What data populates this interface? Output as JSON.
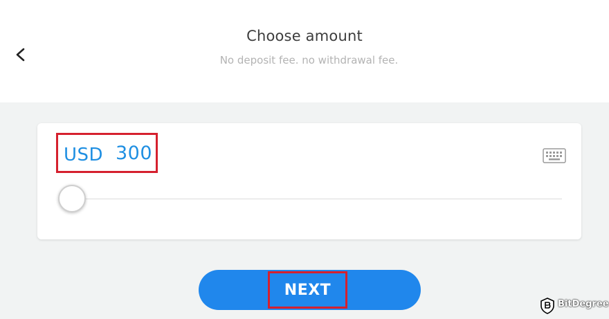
{
  "header": {
    "title": "Choose amount",
    "subtitle": "No deposit fee. no withdrawal fee.",
    "back_icon": "chevron-left-icon"
  },
  "amount": {
    "currency": "USD",
    "value": "300",
    "keyboard_icon": "keyboard-icon",
    "slider_position": 0
  },
  "actions": {
    "next_label": "NEXT"
  },
  "watermark": {
    "text": "BitDegree"
  },
  "colors": {
    "accent": "#2087ec",
    "amount_text": "#1f8fe2",
    "highlight": "#d5202e",
    "background": "#f1f3f3"
  }
}
